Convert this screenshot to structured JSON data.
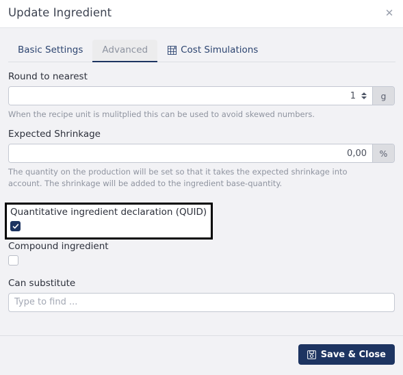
{
  "dialog": {
    "title": "Update Ingredient",
    "close_icon": "close-icon"
  },
  "tabs": [
    {
      "label": "Basic Settings",
      "active": false,
      "icon": null
    },
    {
      "label": "Advanced",
      "active": true,
      "icon": null
    },
    {
      "label": "Cost Simulations",
      "active": false,
      "icon": "table-grid-icon"
    }
  ],
  "fields": {
    "round_to_nearest": {
      "label": "Round to nearest",
      "value": "1",
      "unit": "g",
      "help": "When the recipe unit is mulitplied this can be used to avoid skewed numbers."
    },
    "expected_shrinkage": {
      "label": "Expected Shrinkage",
      "value": "0,00",
      "unit": "%",
      "help": "The quantity on the production will be set so that it takes the expected shrinkage into account. The shrinkage will be added to the ingredient base-quantity."
    },
    "quid": {
      "label": "Quantitative ingredient declaration (QUID)",
      "checked": true
    },
    "compound_ingredient": {
      "label": "Compound ingredient",
      "checked": false
    },
    "can_substitute": {
      "label": "Can substitute",
      "value": "",
      "placeholder": "Type to find ..."
    }
  },
  "footer": {
    "save_label": "Save & Close",
    "save_icon": "floppy-save-icon"
  },
  "colors": {
    "accent": "#1d3461",
    "body_bg": "#f2f2f5",
    "header_bg": "#ffffff",
    "highlight_border": "#000000",
    "addon_bg": "#dcdde1"
  }
}
